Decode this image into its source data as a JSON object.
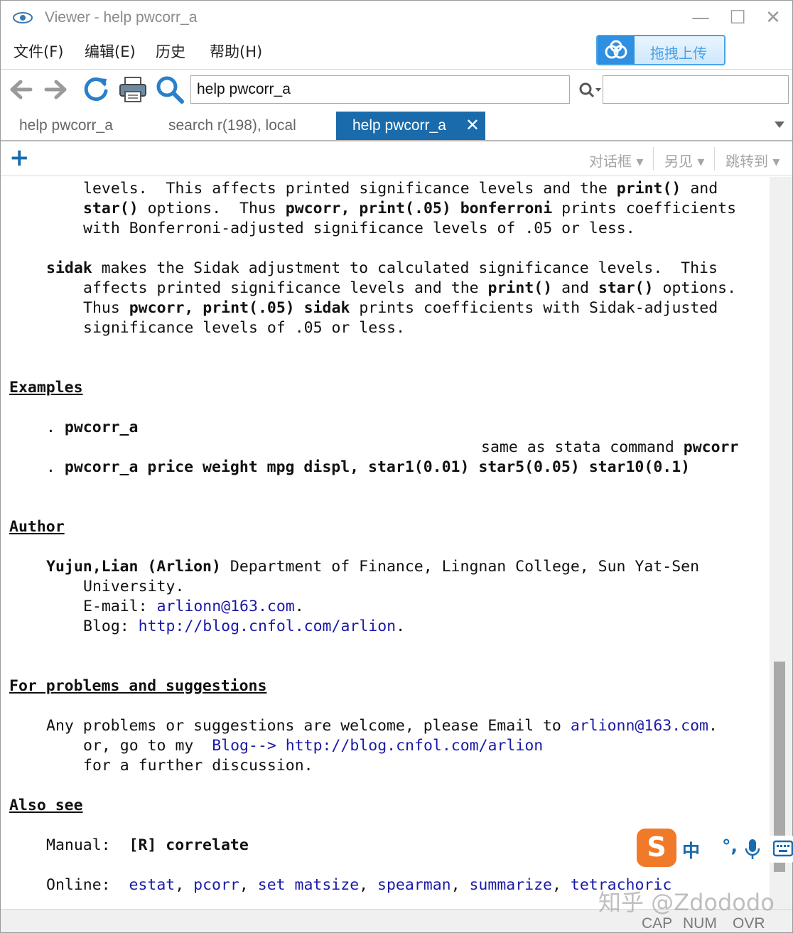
{
  "window": {
    "title": "Viewer - help pwcorr_a",
    "controls": {
      "minimize": "—",
      "maximize": "☐",
      "close": "✕"
    }
  },
  "menu": {
    "items": [
      {
        "label": "文件(F)"
      },
      {
        "label": "编辑(E)"
      },
      {
        "label": "历史"
      },
      {
        "label": "帮助(H)"
      }
    ],
    "upload_label": "拖拽上传"
  },
  "toolbar": {
    "icons": [
      "back-arrow-icon",
      "forward-arrow-icon",
      "refresh-icon",
      "print-icon",
      "search-icon"
    ],
    "address_value": "help pwcorr_a",
    "find_value": ""
  },
  "tabs": [
    {
      "label": "help pwcorr_a",
      "active": false
    },
    {
      "label": "search r(198), local",
      "active": false
    },
    {
      "label": "help pwcorr_a",
      "active": true,
      "close": "✕"
    }
  ],
  "subtoolbar": {
    "add": "+",
    "dialog": "对话框",
    "also_see": "另见",
    "jump_to": "跳转到"
  },
  "doc": {
    "bonf_l1": {
      "a": "levels.  This affects printed significance levels and the ",
      "b": "print()",
      "c": " and"
    },
    "bonf_l2": {
      "a": "star()",
      "b": " options.  Thus ",
      "c": "pwcorr, print(.05) bonferroni",
      "d": " prints coefficients"
    },
    "bonf_l3": "with Bonferroni-adjusted significance levels of .05 or less.",
    "sidak_l1": {
      "a": "sidak",
      "b": " makes the Sidak adjustment to calculated significance levels.  This"
    },
    "sidak_l2": {
      "a": "affects printed significance levels and the ",
      "b": "print()",
      "c": " and ",
      "d": "star()",
      "e": " options."
    },
    "sidak_l3": {
      "a": "Thus ",
      "b": "pwcorr, print(.05) sidak",
      "c": " prints coefficients with Sidak-adjusted"
    },
    "sidak_l4": "significance levels of .05 or less.",
    "examples_heading": "Examples",
    "ex1": {
      "dot": ". ",
      "cmd": "pwcorr_a"
    },
    "ex_note": {
      "a": "same as stata command ",
      "b": "pwcorr"
    },
    "ex2": {
      "dot": ". ",
      "cmd": "pwcorr_a price weight mpg displ, star1(0.01) star5(0.05) star10(0.1)"
    },
    "author_heading": "Author",
    "author_l1": {
      "a": "Yujun,Lian (Arlion)",
      "b": " Department of Finance, Lingnan College, Sun Yat-Sen"
    },
    "author_l2": "University.",
    "author_l3": {
      "a": "E-mail: ",
      "b": "arlionn@163.com",
      "c": "."
    },
    "author_l4": {
      "a": "Blog: ",
      "b": "http://blog.cnfol.com/arlion",
      "c": "."
    },
    "problems_heading": "For problems and suggestions",
    "prob_l1": {
      "a": "Any problems or suggestions are welcome, please Email to ",
      "b": "arlionn@163.com",
      "c": "."
    },
    "prob_l2": {
      "a": "or, go to my  ",
      "b": "Blog-->",
      "c": " ",
      "d": "http://blog.cnfol.com/arlion"
    },
    "prob_l3": "for a further discussion.",
    "also_heading": "Also see",
    "manual": {
      "label": "Manual:  ",
      "value": "[R] correlate"
    },
    "online": {
      "label": "Online:  ",
      "links": [
        "estat",
        "pcorr",
        "set matsize",
        "spearman",
        "summarize",
        "tetrachoric"
      ],
      "sep": ", "
    }
  },
  "status": {
    "cap": "CAP",
    "num": "NUM",
    "ovr": "OVR"
  },
  "ime": {
    "logo": "S",
    "zh": "中",
    "punct": "°,"
  },
  "watermark": "知乎 @Zdododo",
  "colors": {
    "tab_active": "#1a6bab",
    "link": "#1a1aa8",
    "accent": "#2f8fe0"
  }
}
